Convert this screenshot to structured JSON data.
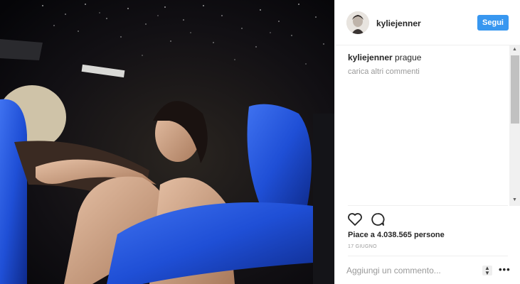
{
  "post": {
    "username": "kyliejenner",
    "follow_label": "Segui",
    "caption_text": "prague",
    "load_more_label": "carica altri commenti",
    "likes_text": "Piace a 4.038.565 persone",
    "date": "17 GIUGNO",
    "comment_placeholder": "Aggiungi un commento...",
    "more_options_label": "•••"
  },
  "icons": {
    "like": "heart-icon",
    "comment": "comment-icon",
    "more": "more-icon",
    "resize": "resize-icon"
  },
  "colors": {
    "follow_button": "#3897f0",
    "seat_blue": "#1f4fd6",
    "text_dark": "#262626",
    "text_muted": "#999999"
  }
}
